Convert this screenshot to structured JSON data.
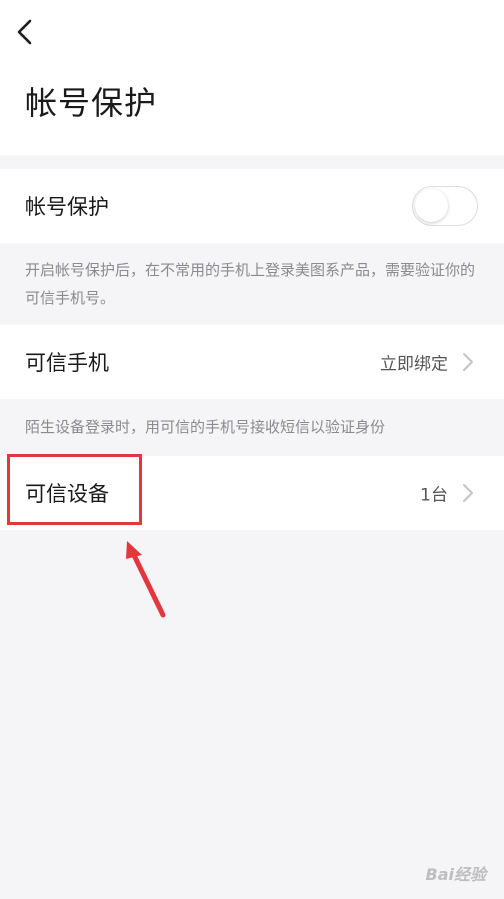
{
  "header": {
    "back_icon": "chevron-left-icon",
    "title": "帐号保护"
  },
  "account_protection": {
    "label": "帐号保护",
    "enabled": false,
    "note": "开启帐号保护后，在不常用的手机上登录美图系产品，需要验证你的可信手机号。"
  },
  "trusted_phone": {
    "label": "可信手机",
    "value": "立即绑定",
    "note": "陌生设备登录时，用可信的手机号接收短信以验证身份"
  },
  "trusted_device": {
    "label": "可信设备",
    "value": "1台"
  },
  "annotation": {
    "color": "#e2373d"
  },
  "watermark": {
    "text": "Bai经验"
  }
}
